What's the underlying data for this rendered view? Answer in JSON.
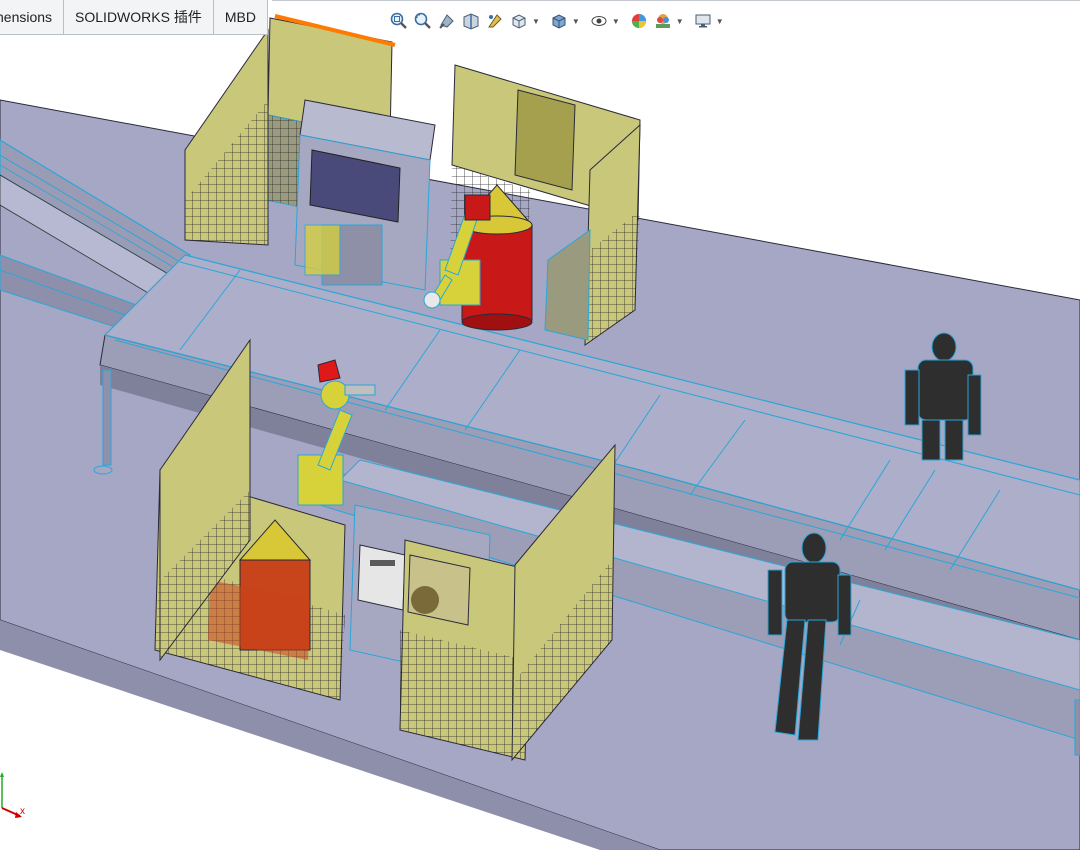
{
  "tabs": [
    {
      "label": "nensions"
    },
    {
      "label": "SOLIDWORKS 插件"
    },
    {
      "label": "MBD"
    }
  ],
  "heads_up_toolbar": [
    {
      "icon": "zoom-to-fit-icon"
    },
    {
      "icon": "zoom-to-area-icon"
    },
    {
      "icon": "previous-view-icon"
    },
    {
      "icon": "section-view-icon"
    },
    {
      "icon": "dynamic-annotation-view-icon"
    },
    {
      "icon": "view-orientation-icon",
      "dropdown": true
    },
    {
      "icon": "display-style-icon",
      "dropdown": true
    },
    {
      "icon": "hide-show-items-icon",
      "dropdown": true
    },
    {
      "icon": "edit-appearance-icon"
    },
    {
      "icon": "apply-scene-icon",
      "dropdown": true
    },
    {
      "icon": "view-settings-icon",
      "dropdown": true
    }
  ],
  "triad": {
    "x_label": "x"
  },
  "colors": {
    "floor": "#a4a6c4",
    "frame": "#9ea1b8",
    "edge": "#2aa6d8",
    "enclosure_glass": "#c9c77a",
    "mesh": "#8a8a6a",
    "robot": "#d7d23a",
    "tank_red": "#c81818",
    "tank_cone": "#d8c837",
    "human": "#2e2e2e",
    "screen": "#4a4a7a"
  }
}
